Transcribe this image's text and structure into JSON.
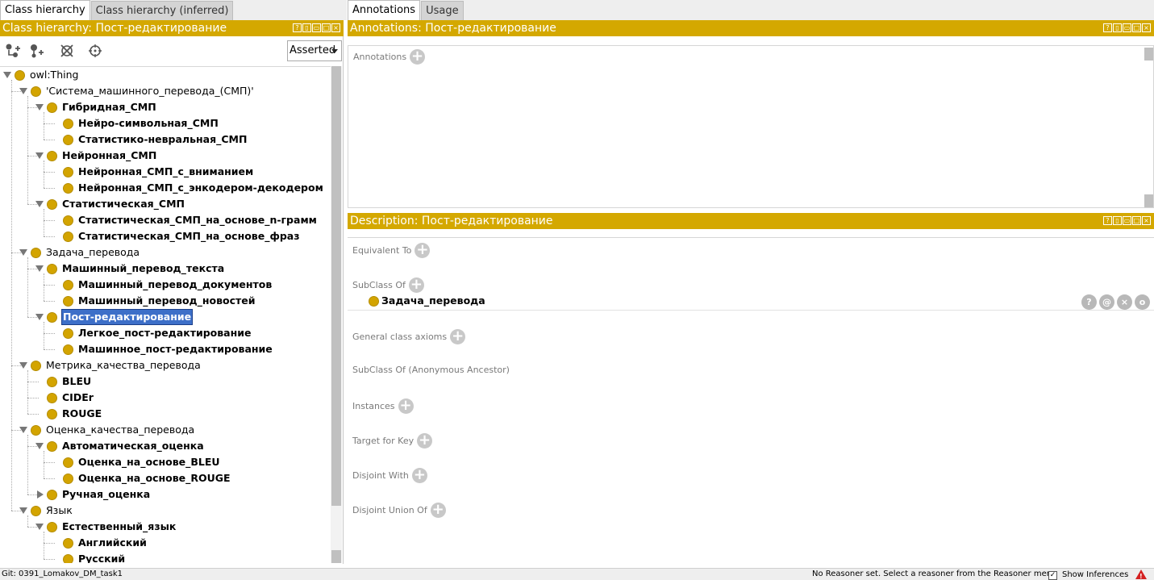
{
  "left_tabs": [
    "Class hierarchy",
    "Class hierarchy (inferred)"
  ],
  "right_tabs": [
    "Annotations",
    "Usage"
  ],
  "left_header": "Class hierarchy: Пост-редактирование",
  "annotations_header": "Annotations: Пост-редактирование",
  "description_header": "Description: Пост-редактирование",
  "toolbar": {
    "add_subclass_icon": "add-subclass-icon",
    "add_sibling_icon": "add-sibling-icon",
    "delete_icon": "delete-class-icon",
    "watch_icon": "crosshair-icon",
    "mode": "Asserted"
  },
  "tree": [
    {
      "label": "owl:Thing",
      "level": 0,
      "toggle": "open",
      "bold": false
    },
    {
      "label": "'Система_машинного_перевода_(СМП)'",
      "level": 1,
      "toggle": "open",
      "bold": false
    },
    {
      "label": "Гибридная_СМП",
      "level": 2,
      "toggle": "open",
      "bold": true
    },
    {
      "label": "Нейро-символьная_СМП",
      "level": 3,
      "toggle": "none",
      "bold": true
    },
    {
      "label": "Статистико-невральная_СМП",
      "level": 3,
      "toggle": "none",
      "bold": true
    },
    {
      "label": "Нейронная_СМП",
      "level": 2,
      "toggle": "open",
      "bold": true
    },
    {
      "label": "Нейронная_СМП_с_вниманием",
      "level": 3,
      "toggle": "none",
      "bold": true
    },
    {
      "label": "Нейронная_СМП_с_энкодером-декодером",
      "level": 3,
      "toggle": "none",
      "bold": true
    },
    {
      "label": "Статистическая_СМП",
      "level": 2,
      "toggle": "open",
      "bold": true
    },
    {
      "label": "Статистическая_СМП_на_основе_n-грамм",
      "level": 3,
      "toggle": "none",
      "bold": true
    },
    {
      "label": "Статистическая_СМП_на_основе_фраз",
      "level": 3,
      "toggle": "none",
      "bold": true
    },
    {
      "label": "Задача_перевода",
      "level": 1,
      "toggle": "open",
      "bold": false
    },
    {
      "label": "Машинный_перевод_текста",
      "level": 2,
      "toggle": "open",
      "bold": true
    },
    {
      "label": "Машинный_перевод_документов",
      "level": 3,
      "toggle": "none",
      "bold": true
    },
    {
      "label": "Машинный_перевод_новостей",
      "level": 3,
      "toggle": "none",
      "bold": true
    },
    {
      "label": "Пост-редактирование",
      "level": 2,
      "toggle": "open",
      "bold": true,
      "selected": true
    },
    {
      "label": "Легкое_пост-редактирование",
      "level": 3,
      "toggle": "none",
      "bold": true
    },
    {
      "label": "Машинное_пост-редактирование",
      "level": 3,
      "toggle": "none",
      "bold": true
    },
    {
      "label": "Метрика_качества_перевода",
      "level": 1,
      "toggle": "open",
      "bold": false
    },
    {
      "label": "BLEU",
      "level": 2,
      "toggle": "none",
      "bold": true
    },
    {
      "label": "CIDEr",
      "level": 2,
      "toggle": "none",
      "bold": true
    },
    {
      "label": "ROUGE",
      "level": 2,
      "toggle": "none",
      "bold": true
    },
    {
      "label": "Оценка_качества_перевода",
      "level": 1,
      "toggle": "open",
      "bold": false
    },
    {
      "label": "Автоматическая_оценка",
      "level": 2,
      "toggle": "open",
      "bold": true
    },
    {
      "label": "Оценка_на_основе_BLEU",
      "level": 3,
      "toggle": "none",
      "bold": true
    },
    {
      "label": "Оценка_на_основе_ROUGE",
      "level": 3,
      "toggle": "none",
      "bold": true
    },
    {
      "label": "Ручная_оценка",
      "level": 2,
      "toggle": "closed",
      "bold": true
    },
    {
      "label": "Язык",
      "level": 1,
      "toggle": "open",
      "bold": false
    },
    {
      "label": "Естественный_язык",
      "level": 2,
      "toggle": "open",
      "bold": true
    },
    {
      "label": "Английский",
      "level": 3,
      "toggle": "none",
      "bold": true
    },
    {
      "label": "Русский",
      "level": 3,
      "toggle": "none",
      "bold": true
    }
  ],
  "annotations": {
    "label": "Annotations"
  },
  "description": {
    "sections": [
      {
        "label": "Equivalent To",
        "plus": true
      },
      {
        "label": "SubClass Of",
        "plus": true
      },
      {
        "label": "General class axioms",
        "plus": true
      },
      {
        "label": "SubClass Of (Anonymous Ancestor)",
        "plus": false
      },
      {
        "label": "Instances",
        "plus": true
      },
      {
        "label": "Target for Key",
        "plus": true
      },
      {
        "label": "Disjoint With",
        "plus": true
      },
      {
        "label": "Disjoint Union Of",
        "plus": true
      }
    ],
    "subclass_entry": "Задача_перевода",
    "row_buttons": [
      "?",
      "@",
      "×",
      "o"
    ]
  },
  "status": {
    "git": "Git: 0391_Lomakov_DM_task1",
    "reasoner": "No Reasoner set. Select a reasoner from the Reasoner menu",
    "show_inferences": "Show Inferences",
    "show_inferences_checked": true
  }
}
